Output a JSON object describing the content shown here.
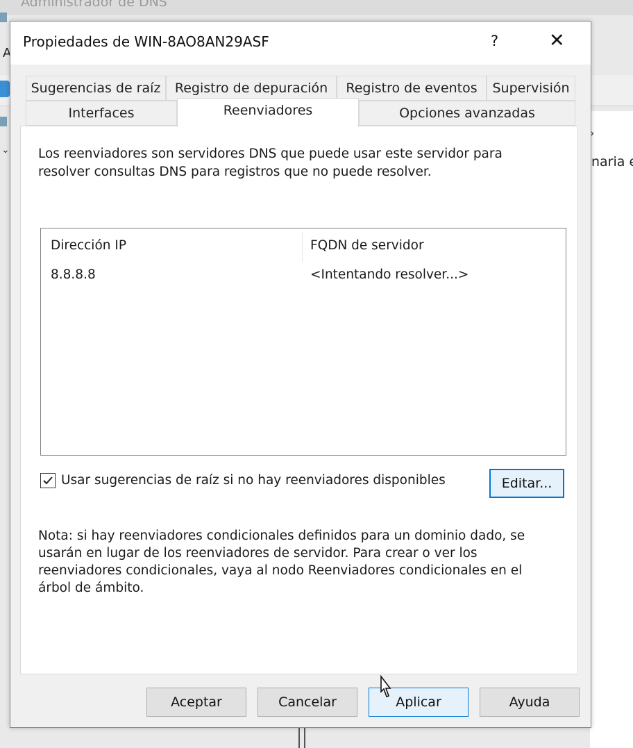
{
  "background": {
    "top_text": "Administrador de DNS",
    "left_letter": "A",
    "right_text": "naria e"
  },
  "dialog": {
    "title": "Propiedades de WIN-8AO8AN29ASF",
    "help_glyph": "?",
    "close_glyph": "✕",
    "tabs_row1": [
      "Sugerencias de raíz",
      "Registro de depuración",
      "Registro de eventos",
      "Supervisión"
    ],
    "tabs_row2": [
      "Interfaces",
      "Reenviadores",
      "Opciones avanzadas"
    ],
    "active_tab": "Reenviadores",
    "intro_text": "Los reenviadores son servidores DNS que puede usar este servidor para resolver consultas DNS para registros que no puede resolver.",
    "list": {
      "columns": [
        "Dirección IP",
        "FQDN de servidor"
      ],
      "rows": [
        {
          "ip": "8.8.8.8",
          "fqdn": "<Intentando resolver...>"
        }
      ]
    },
    "use_root_hints": {
      "checked": true,
      "label": "Usar sugerencias de raíz si no hay reenviadores disponibles"
    },
    "edit_button": "Editar...",
    "note_text": "Nota: si hay reenviadores condicionales definidos para un dominio dado, se usarán en lugar de los reenviadores de servidor. Para crear o ver los reenviadores condicionales, vaya al nodo Reenviadores condicionales en el árbol de ámbito.",
    "buttons": {
      "ok": "Aceptar",
      "cancel": "Cancelar",
      "apply": "Aplicar",
      "help": "Ayuda"
    }
  },
  "colors": {
    "accent": "#0078d7",
    "dialog_bg": "#f0f0f0",
    "panel_bg": "#ffffff"
  }
}
